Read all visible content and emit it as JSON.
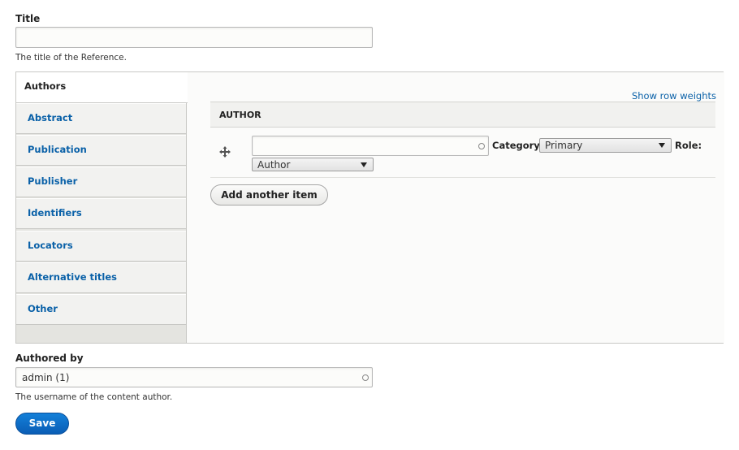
{
  "title_field": {
    "label": "Title",
    "value": "",
    "description": "The title of the Reference."
  },
  "tabs": {
    "items": [
      {
        "label": "Authors",
        "active": true
      },
      {
        "label": "Abstract",
        "active": false
      },
      {
        "label": "Publication",
        "active": false
      },
      {
        "label": "Publisher",
        "active": false
      },
      {
        "label": "Identifiers",
        "active": false
      },
      {
        "label": "Locators",
        "active": false
      },
      {
        "label": "Alternative titles",
        "active": false
      },
      {
        "label": "Other",
        "active": false
      }
    ]
  },
  "authors_pane": {
    "show_row_weights_link": "Show row weights",
    "table_header": "AUTHOR",
    "row": {
      "name_value": "",
      "category_label": "Category:",
      "category_selected": "Primary",
      "role_label": "Role:",
      "role_selected": "Author"
    },
    "add_another_item_label": "Add another item"
  },
  "authored_by": {
    "label": "Authored by",
    "value": "admin (1)",
    "description": "The username of the content author."
  },
  "save_label": "Save",
  "colors": {
    "link": "#0a61a8",
    "primary_button": "#0a6fc9"
  },
  "icons": {
    "drag_handle": "drag-move-icon",
    "autocomplete": "autocomplete-circle-icon",
    "select_arrow": "chevron-down-icon"
  }
}
